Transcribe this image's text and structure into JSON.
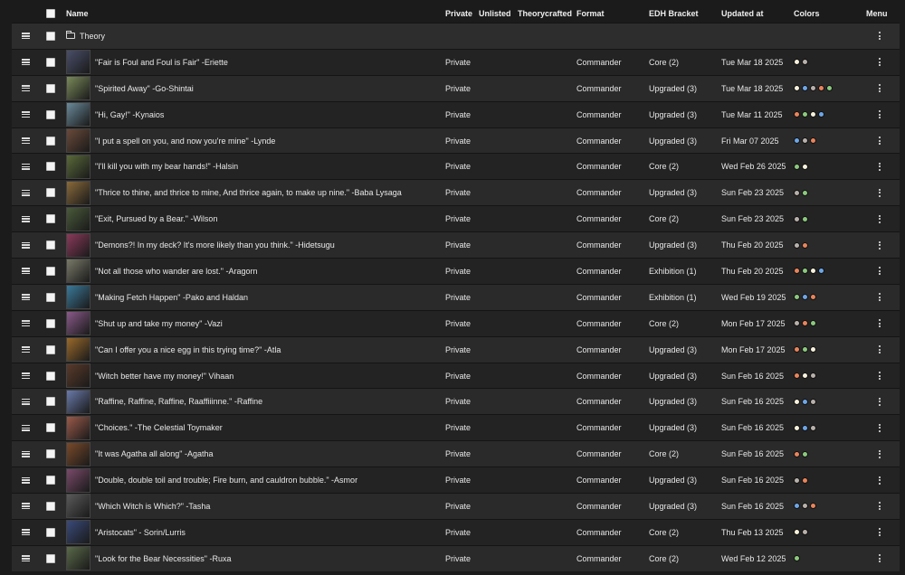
{
  "columns": {
    "name": "Name",
    "private": "Private",
    "unlisted": "Unlisted",
    "theorycrafted": "Theorycrafted",
    "format": "Format",
    "bracket": "EDH Bracket",
    "updated": "Updated at",
    "colors": "Colors",
    "menu": "Menu"
  },
  "folder": {
    "name": "Theory"
  },
  "color_map": {
    "W": "#f5f1dc",
    "U": "#6ea6e6",
    "B": "#b8b0aa",
    "R": "#e9845b",
    "G": "#8cc97e"
  },
  "decks": [
    {
      "name": "\"Fair is Foul and Foul is Fair\" -Eriette",
      "private": "Private",
      "format": "Commander",
      "bracket": "Core (2)",
      "updated": "Tue Mar 18 2025",
      "colors": [
        "W",
        "B"
      ],
      "thumb": "#4a4f6a"
    },
    {
      "name": "\"Spirited Away\" -Go-Shintai",
      "private": "Private",
      "format": "Commander",
      "bracket": "Upgraded (3)",
      "updated": "Tue Mar 18 2025",
      "colors": [
        "W",
        "U",
        "B",
        "R",
        "G"
      ],
      "thumb": "#7a8a5a"
    },
    {
      "name": "\"Hi, Gay!\" -Kynaios",
      "private": "Private",
      "format": "Commander",
      "bracket": "Upgraded (3)",
      "updated": "Tue Mar 11 2025",
      "colors": [
        "R",
        "G",
        "W",
        "U"
      ],
      "thumb": "#6a8a9a"
    },
    {
      "name": "\"I put a spell on you, and now you're mine\" -Lynde",
      "private": "Private",
      "format": "Commander",
      "bracket": "Upgraded (3)",
      "updated": "Fri Mar 07 2025",
      "colors": [
        "U",
        "B",
        "R"
      ],
      "thumb": "#6a4a3a"
    },
    {
      "name": "\"I'll kill you with my bear hands!\" -Halsin",
      "private": "Private",
      "format": "Commander",
      "bracket": "Core (2)",
      "updated": "Wed Feb 26 2025",
      "colors": [
        "G",
        "W"
      ],
      "thumb": "#5a6a3a"
    },
    {
      "name": "\"Thrice to thine, and thrice to mine, And thrice again, to make up nine.\" -Baba Lysaga",
      "private": "Private",
      "format": "Commander",
      "bracket": "Upgraded (3)",
      "updated": "Sun Feb 23 2025",
      "colors": [
        "B",
        "G"
      ],
      "thumb": "#8a6a3a"
    },
    {
      "name": "\"Exit, Pursued by a Bear.\" -Wilson",
      "private": "Private",
      "format": "Commander",
      "bracket": "Core (2)",
      "updated": "Sun Feb 23 2025",
      "colors": [
        "B",
        "G"
      ],
      "thumb": "#4a5a3a"
    },
    {
      "name": "\"Demons?! In my deck? It's more likely than you think.\" -Hidetsugu",
      "private": "Private",
      "format": "Commander",
      "bracket": "Upgraded (3)",
      "updated": "Thu Feb 20 2025",
      "colors": [
        "B",
        "R"
      ],
      "thumb": "#8a3a5a"
    },
    {
      "name": "\"Not all those who wander are lost.\" -Aragorn",
      "private": "Private",
      "format": "Commander",
      "bracket": "Exhibition (1)",
      "updated": "Thu Feb 20 2025",
      "colors": [
        "R",
        "G",
        "W",
        "U"
      ],
      "thumb": "#7a7a6a"
    },
    {
      "name": "\"Making Fetch Happen\" -Pako and Haldan",
      "private": "Private",
      "format": "Commander",
      "bracket": "Exhibition (1)",
      "updated": "Wed Feb 19 2025",
      "colors": [
        "G",
        "U",
        "R"
      ],
      "thumb": "#3a7a9a"
    },
    {
      "name": "\"Shut up and take my money\" -Vazi",
      "private": "Private",
      "format": "Commander",
      "bracket": "Core (2)",
      "updated": "Mon Feb 17 2025",
      "colors": [
        "B",
        "R",
        "G"
      ],
      "thumb": "#8a5a8a"
    },
    {
      "name": "\"Can I offer you a nice egg in this trying time?\" -Atla",
      "private": "Private",
      "format": "Commander",
      "bracket": "Upgraded (3)",
      "updated": "Mon Feb 17 2025",
      "colors": [
        "R",
        "G",
        "W"
      ],
      "thumb": "#9a6a2a"
    },
    {
      "name": "\"Witch better have my money!\" Vihaan",
      "private": "Private",
      "format": "Commander",
      "bracket": "Upgraded (3)",
      "updated": "Sun Feb 16 2025",
      "colors": [
        "R",
        "W",
        "B"
      ],
      "thumb": "#5a3a2a"
    },
    {
      "name": "\"Raffine, Raffine, Raffine, Raaffiiinne.\" -Raffine",
      "private": "Private",
      "format": "Commander",
      "bracket": "Upgraded (3)",
      "updated": "Sun Feb 16 2025",
      "colors": [
        "W",
        "U",
        "B"
      ],
      "thumb": "#6a7aaa"
    },
    {
      "name": "\"Choices.\" -The Celestial Toymaker",
      "private": "Private",
      "format": "Commander",
      "bracket": "Upgraded (3)",
      "updated": "Sun Feb 16 2025",
      "colors": [
        "W",
        "U",
        "B"
      ],
      "thumb": "#9a5a4a"
    },
    {
      "name": "\"It was Agatha all along\" -Agatha",
      "private": "Private",
      "format": "Commander",
      "bracket": "Core (2)",
      "updated": "Sun Feb 16 2025",
      "colors": [
        "R",
        "G"
      ],
      "thumb": "#7a4a2a"
    },
    {
      "name": "\"Double, double toil and trouble; Fire burn, and cauldron bubble.\" -Asmor",
      "private": "Private",
      "format": "Commander",
      "bracket": "Upgraded (3)",
      "updated": "Sun Feb 16 2025",
      "colors": [
        "B",
        "R"
      ],
      "thumb": "#7a4a6a"
    },
    {
      "name": "\"Which Witch is Which?\" -Tasha",
      "private": "Private",
      "format": "Commander",
      "bracket": "Upgraded (3)",
      "updated": "Sun Feb 16 2025",
      "colors": [
        "U",
        "B",
        "R"
      ],
      "thumb": "#5a5a5a"
    },
    {
      "name": "\"Aristocats\" - Sorin/Lurris",
      "private": "Private",
      "format": "Commander",
      "bracket": "Core (2)",
      "updated": "Thu Feb 13 2025",
      "colors": [
        "W",
        "B"
      ],
      "thumb": "#3a4a7a"
    },
    {
      "name": "\"Look for the Bear Necessities\" -Ruxa",
      "private": "Private",
      "format": "Commander",
      "bracket": "Core (2)",
      "updated": "Wed Feb 12 2025",
      "colors": [
        "G"
      ],
      "thumb": "#5a6a4a"
    }
  ]
}
